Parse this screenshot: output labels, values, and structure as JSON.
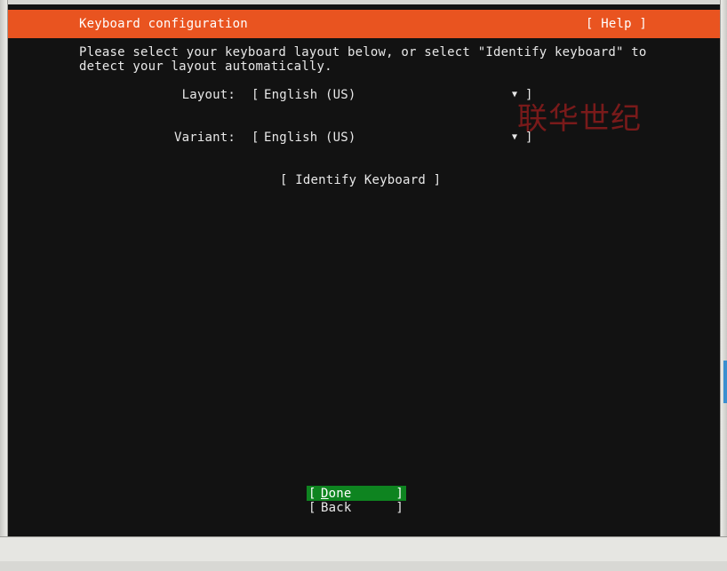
{
  "header": {
    "title": "Keyboard configuration",
    "help": "[ Help ]"
  },
  "intro": {
    "line1": "Please select your keyboard layout below, or select \"Identify keyboard\" to",
    "line2": "detect your layout automatically."
  },
  "layout": {
    "label": "Layout:",
    "open": "[",
    "value": "English (US)",
    "arrow": "▼",
    "close": "]"
  },
  "variant": {
    "label": "Variant:",
    "open": "[",
    "value": "English (US)",
    "arrow": "▼",
    "close": "]"
  },
  "identify_button": "[ Identify Keyboard ]",
  "watermark": "联华世纪",
  "buttons": {
    "done": {
      "open": "[",
      "first": "D",
      "rest": "one",
      "close": "]"
    },
    "back": {
      "open": "[",
      "label": "Back",
      "close": "]"
    }
  },
  "colors": {
    "header_bg": "#e95420",
    "screen_bg": "#121212",
    "done_bg": "#0e8420",
    "text": "#e8e8e8"
  }
}
